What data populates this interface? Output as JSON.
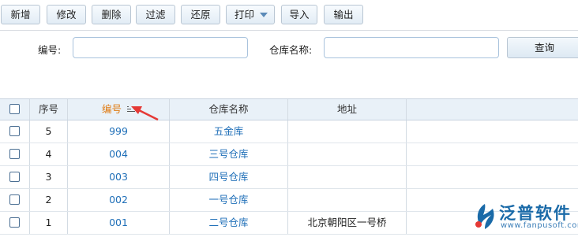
{
  "toolbar": {
    "buttons": [
      "新增",
      "修改",
      "删除",
      "过滤",
      "还原",
      "打印",
      "导入",
      "输出"
    ]
  },
  "search": {
    "code_label": "编号:",
    "code_value": "",
    "warehouse_label": "仓库名称:",
    "warehouse_value": "",
    "query_button": "查询"
  },
  "grid": {
    "columns": [
      "序号",
      "编号",
      "仓库名称",
      "地址"
    ],
    "sorted_column": "编号",
    "rows": [
      {
        "seq": "5",
        "code": "999",
        "name": "五金库",
        "address": ""
      },
      {
        "seq": "4",
        "code": "004",
        "name": "三号仓库",
        "address": ""
      },
      {
        "seq": "3",
        "code": "003",
        "name": "四号仓库",
        "address": ""
      },
      {
        "seq": "2",
        "code": "002",
        "name": "一号仓库",
        "address": ""
      },
      {
        "seq": "1",
        "code": "001",
        "name": "二号仓库",
        "address": "北京朝阳区一号桥"
      }
    ]
  },
  "watermark": {
    "brand": "泛普软件",
    "url": "www.fanpusoft.com"
  },
  "colors": {
    "accent": "#1f6fb8",
    "sorted_header": "#e07a10",
    "arrow": "#e53935",
    "header_bg": "#e9f1f8"
  }
}
